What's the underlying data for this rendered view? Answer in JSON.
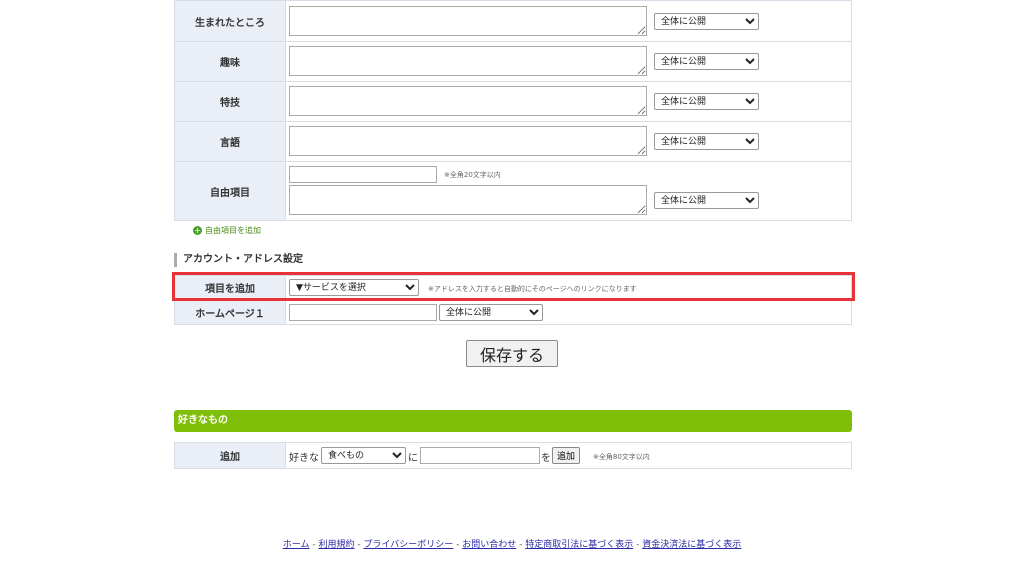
{
  "profile_rows": [
    {
      "label": "生まれたところ",
      "visibility": "全体に公開"
    },
    {
      "label": "趣味",
      "visibility": "全体に公開"
    },
    {
      "label": "特技",
      "visibility": "全体に公開"
    },
    {
      "label": "言語",
      "visibility": "全体に公開"
    }
  ],
  "free_item": {
    "label": "自由項目",
    "note": "※全角20文字以内",
    "visibility": "全体に公開"
  },
  "add_free_item_link": "自由項目を追加",
  "account_section": {
    "title": "アカウント・アドレス設定",
    "add_item_label": "項目を追加",
    "service_select": "▼サービスを選択",
    "service_note": "※アドレスを入力すると自動的にそのページへのリンクになります",
    "homepage_label": "ホームページ１",
    "homepage_visibility": "全体に公開"
  },
  "save_button": "保存する",
  "favorites": {
    "title": "好きなもの",
    "row_label": "追加",
    "prefix": "好きな",
    "category": "食べもの",
    "ni": "に",
    "wo": "を",
    "add_button": "追加",
    "note": "※全角80文字以内"
  },
  "footer": {
    "links": [
      "ホーム",
      "利用規約",
      "プライバシーポリシー",
      "お問い合わせ",
      "特定商取引法に基づく表示",
      "資金決済法に基づく表示"
    ],
    "separator": " - "
  },
  "colors": {
    "section_green": "#7fbf0a",
    "label_bg": "#e9eef7",
    "highlight_red": "#e8323a"
  }
}
